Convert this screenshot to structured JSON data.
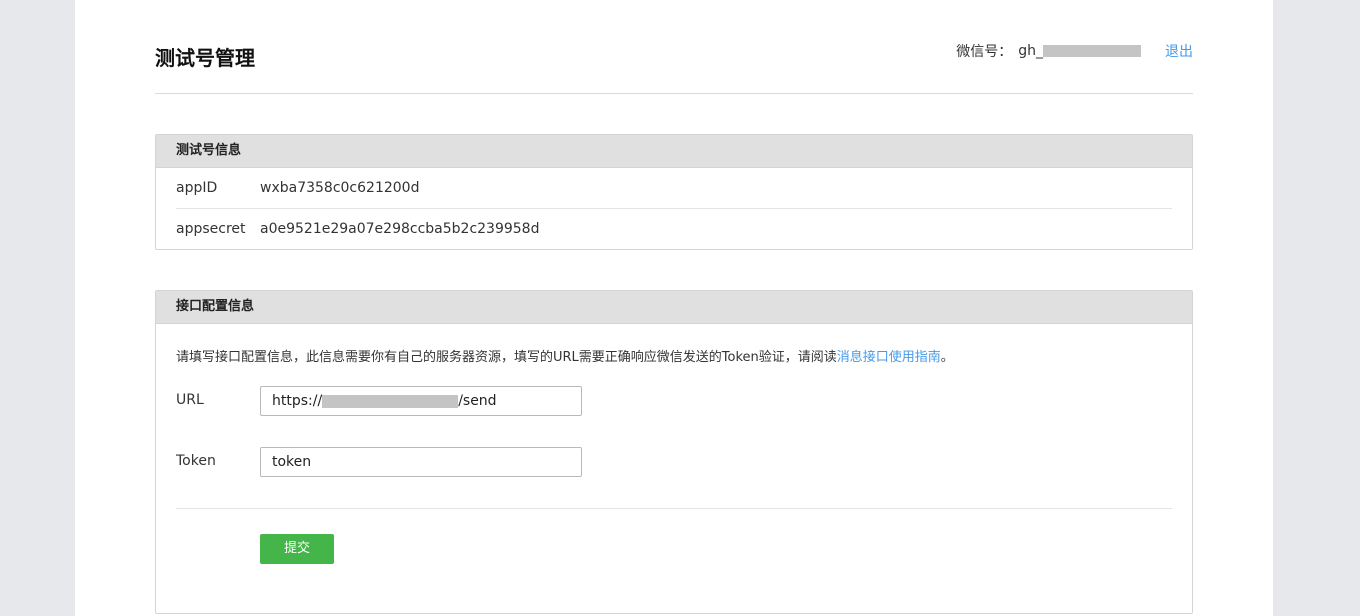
{
  "header": {
    "title": "测试号管理",
    "wechat_label": "微信号：",
    "wechat_id_prefix": "gh_",
    "logout": "退出"
  },
  "account_info": {
    "section_title": "测试号信息",
    "rows": [
      {
        "key": "appID",
        "value": "wxba7358c0c621200d"
      },
      {
        "key": "appsecret",
        "value": "a0e9521e29a07e298ccba5b2c239958d"
      }
    ]
  },
  "interface_config": {
    "section_title": "接口配置信息",
    "description": "请填写接口配置信息，此信息需要你有自己的服务器资源，填写的URL需要正确响应微信发送的Token验证，请阅读",
    "link_text": "消息接口使用指南",
    "description_end": "。",
    "url_label": "URL",
    "url_prefix": "https://",
    "url_suffix": "/send",
    "token_label": "Token",
    "token_value": "token",
    "submit": "提交"
  },
  "colors": {
    "accent_link": "#459ae9",
    "submit_green": "#44b549",
    "redaction": "#c4c4c4"
  }
}
